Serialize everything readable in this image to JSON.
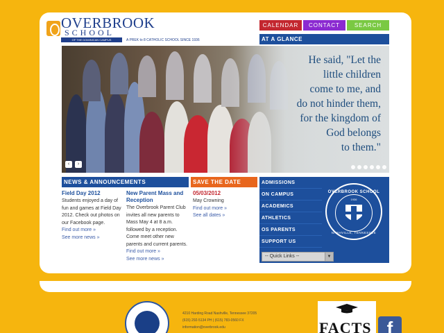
{
  "logo": {
    "title": "OVERBROOK",
    "subtitle": "SCHOOL",
    "bar_text": "OF THE DOMINICAN CAMPUS",
    "tagline": "A PREK to 8 CATHOLIC SCHOOL SINCE 1936"
  },
  "nav": {
    "calendar": "CALENDAR",
    "contact": "CONTACT",
    "search": "SEARCH"
  },
  "at_a_glance": "AT A GLANCE",
  "hero": {
    "quote_lines": [
      "He said, \"Let the",
      "little children",
      "come to me, and",
      "do not hinder them,",
      "for the kingdom of",
      "God belongs",
      "to them.\""
    ],
    "prev": "‹",
    "next": "›"
  },
  "news": {
    "header": "NEWS & ANNOUNCEMENTS",
    "item1": {
      "title": "Field Day 2012",
      "body": "Students enjoyed a day of fun and games at Field Day 2012. Check out photos on our Facebook page.",
      "more": "Find out more »"
    },
    "item2": {
      "title": "New Parent Mass and Reception",
      "body": "The Overbrook Parent Club invites all new parents to Mass May 4 at 8 a.m. followed by a reception. Come meet other new parents and current parents.",
      "more": "Find out more »"
    },
    "see_more_1": "See more news »",
    "see_more_2": "See more news »"
  },
  "save_date": {
    "header": "SAVE THE DATE",
    "date": "05/03/2012",
    "event": "May Crowning",
    "more": "Find out more »",
    "see_all": "See all dates »"
  },
  "menu": {
    "items": [
      "ADMISSIONS",
      "ON CAMPUS",
      "ACADEMICS",
      "ATHLETICS",
      "OS PARENTS",
      "SUPPORT US"
    ],
    "quick_links": "-- Quick Links --",
    "seal_top": "OVERBROOK SCHOOL",
    "seal_year": "1936",
    "seal_bottom": "NASHVILLE, TENNESSEE"
  },
  "footer": {
    "address": "4210 Harding Road Nashville, Tennessee 37205",
    "phone": "(615) 292-5134 PH | (615) 783-0560 FX",
    "email": "information@overbrook.edu",
    "facts": "FACTS",
    "facebook": "f"
  },
  "colors": {
    "background": "#f6b50e",
    "calendar": "#c3272f",
    "contact": "#8b2ad1",
    "search": "#7ac943",
    "news_header": "#1d4f9c",
    "save_header": "#e8661d",
    "menu": "#1d4f9c"
  }
}
